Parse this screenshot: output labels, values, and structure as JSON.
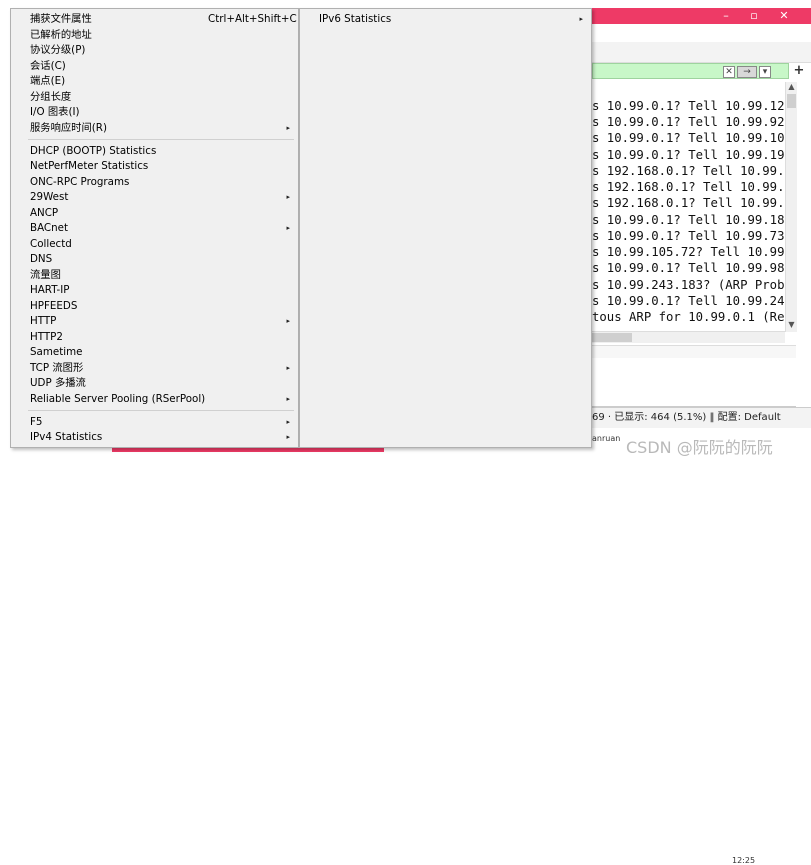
{
  "menu": {
    "items": [
      {
        "label": "捕获文件属性",
        "shortcut": "Ctrl+Alt+Shift+C"
      },
      {
        "label": "已解析的地址"
      },
      {
        "label": "协议分级(P)"
      },
      {
        "label": "会话(C)"
      },
      {
        "label": "端点(E)"
      },
      {
        "label": "分组长度"
      },
      {
        "label": "I/O 图表(I)"
      },
      {
        "label": "服务响应时间(R)",
        "submenu": true
      },
      {
        "label": "DHCP (BOOTP) Statistics"
      },
      {
        "label": "NetPerfMeter Statistics"
      },
      {
        "label": "ONC-RPC Programs"
      },
      {
        "label": "29West",
        "submenu": true
      },
      {
        "label": "ANCP"
      },
      {
        "label": "BACnet",
        "submenu": true
      },
      {
        "label": "Collectd"
      },
      {
        "label": "DNS"
      },
      {
        "label": "流量图"
      },
      {
        "label": "HART-IP"
      },
      {
        "label": "HPFEEDS"
      },
      {
        "label": "HTTP",
        "submenu": true
      },
      {
        "label": "HTTP2"
      },
      {
        "label": "Sametime"
      },
      {
        "label": "TCP 流图形",
        "submenu": true
      },
      {
        "label": "UDP 多播流"
      },
      {
        "label": "Reliable Server Pooling (RSerPool)",
        "submenu": true
      },
      {
        "label": "F5",
        "submenu": true
      },
      {
        "label": "IPv4 Statistics",
        "submenu": true
      }
    ],
    "submenu_arrow": "▸"
  },
  "submenu": {
    "items": [
      {
        "label": "IPv6 Statistics",
        "submenu": true
      }
    ]
  },
  "window": {
    "title_buttons": [
      "–",
      "▫",
      "✕"
    ],
    "filter_clear": "✕",
    "filter_apply": "→",
    "filter_dropdown": "▾",
    "filter_add": "+"
  },
  "packets": [
    "s 10.99.0.1? Tell 10.99.12",
    "s 10.99.0.1? Tell 10.99.92",
    "s 10.99.0.1? Tell 10.99.10",
    "s 10.99.0.1? Tell 10.99.19",
    "s 192.168.0.1? Tell 10.99.",
    "s 192.168.0.1? Tell 10.99.",
    "s 192.168.0.1? Tell 10.99.",
    "s 10.99.0.1? Tell 10.99.18",
    "s 10.99.0.1? Tell 10.99.73",
    "s 10.99.105.72? Tell 10.99",
    "s 10.99.0.1? Tell 10.99.98",
    "s 10.99.243.183? (ARP Prob",
    "s 10.99.0.1? Tell 10.99.24",
    "tous ARP for 10.99.0.1 (Re"
  ],
  "statusbar": {
    "text": "69 · 已显示: 464 (5.1%) ‖ 配置: Default"
  },
  "taskbar": {
    "app_text": "anruan",
    "clock_time": "12:25",
    "watermark": "CSDN @阮阮的阮阮"
  },
  "colors": {
    "accent": "#ee3a66",
    "filter_ok": "#c8f7c8",
    "menu_bg": "#f0f0f0"
  }
}
